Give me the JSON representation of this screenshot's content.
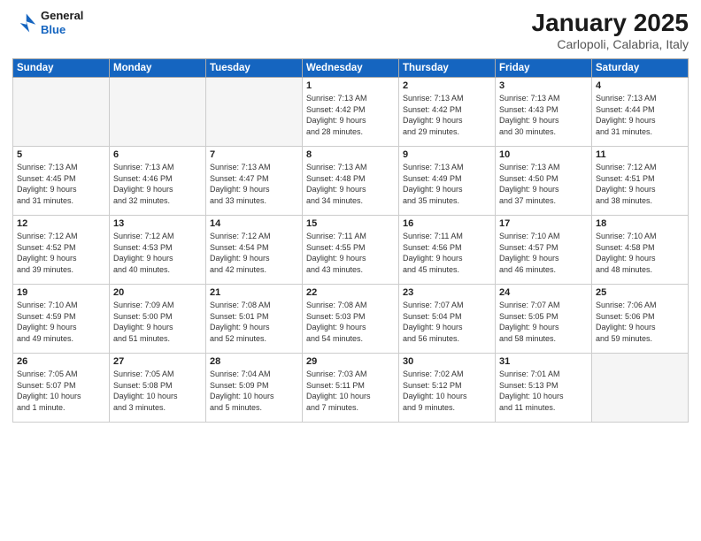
{
  "logo": {
    "line1": "General",
    "line2": "Blue"
  },
  "header": {
    "title": "January 2025",
    "location": "Carlopoli, Calabria, Italy"
  },
  "weekdays": [
    "Sunday",
    "Monday",
    "Tuesday",
    "Wednesday",
    "Thursday",
    "Friday",
    "Saturday"
  ],
  "weeks": [
    [
      {
        "day": "",
        "info": ""
      },
      {
        "day": "",
        "info": ""
      },
      {
        "day": "",
        "info": ""
      },
      {
        "day": "1",
        "info": "Sunrise: 7:13 AM\nSunset: 4:42 PM\nDaylight: 9 hours\nand 28 minutes."
      },
      {
        "day": "2",
        "info": "Sunrise: 7:13 AM\nSunset: 4:42 PM\nDaylight: 9 hours\nand 29 minutes."
      },
      {
        "day": "3",
        "info": "Sunrise: 7:13 AM\nSunset: 4:43 PM\nDaylight: 9 hours\nand 30 minutes."
      },
      {
        "day": "4",
        "info": "Sunrise: 7:13 AM\nSunset: 4:44 PM\nDaylight: 9 hours\nand 31 minutes."
      }
    ],
    [
      {
        "day": "5",
        "info": "Sunrise: 7:13 AM\nSunset: 4:45 PM\nDaylight: 9 hours\nand 31 minutes."
      },
      {
        "day": "6",
        "info": "Sunrise: 7:13 AM\nSunset: 4:46 PM\nDaylight: 9 hours\nand 32 minutes."
      },
      {
        "day": "7",
        "info": "Sunrise: 7:13 AM\nSunset: 4:47 PM\nDaylight: 9 hours\nand 33 minutes."
      },
      {
        "day": "8",
        "info": "Sunrise: 7:13 AM\nSunset: 4:48 PM\nDaylight: 9 hours\nand 34 minutes."
      },
      {
        "day": "9",
        "info": "Sunrise: 7:13 AM\nSunset: 4:49 PM\nDaylight: 9 hours\nand 35 minutes."
      },
      {
        "day": "10",
        "info": "Sunrise: 7:13 AM\nSunset: 4:50 PM\nDaylight: 9 hours\nand 37 minutes."
      },
      {
        "day": "11",
        "info": "Sunrise: 7:12 AM\nSunset: 4:51 PM\nDaylight: 9 hours\nand 38 minutes."
      }
    ],
    [
      {
        "day": "12",
        "info": "Sunrise: 7:12 AM\nSunset: 4:52 PM\nDaylight: 9 hours\nand 39 minutes."
      },
      {
        "day": "13",
        "info": "Sunrise: 7:12 AM\nSunset: 4:53 PM\nDaylight: 9 hours\nand 40 minutes."
      },
      {
        "day": "14",
        "info": "Sunrise: 7:12 AM\nSunset: 4:54 PM\nDaylight: 9 hours\nand 42 minutes."
      },
      {
        "day": "15",
        "info": "Sunrise: 7:11 AM\nSunset: 4:55 PM\nDaylight: 9 hours\nand 43 minutes."
      },
      {
        "day": "16",
        "info": "Sunrise: 7:11 AM\nSunset: 4:56 PM\nDaylight: 9 hours\nand 45 minutes."
      },
      {
        "day": "17",
        "info": "Sunrise: 7:10 AM\nSunset: 4:57 PM\nDaylight: 9 hours\nand 46 minutes."
      },
      {
        "day": "18",
        "info": "Sunrise: 7:10 AM\nSunset: 4:58 PM\nDaylight: 9 hours\nand 48 minutes."
      }
    ],
    [
      {
        "day": "19",
        "info": "Sunrise: 7:10 AM\nSunset: 4:59 PM\nDaylight: 9 hours\nand 49 minutes."
      },
      {
        "day": "20",
        "info": "Sunrise: 7:09 AM\nSunset: 5:00 PM\nDaylight: 9 hours\nand 51 minutes."
      },
      {
        "day": "21",
        "info": "Sunrise: 7:08 AM\nSunset: 5:01 PM\nDaylight: 9 hours\nand 52 minutes."
      },
      {
        "day": "22",
        "info": "Sunrise: 7:08 AM\nSunset: 5:03 PM\nDaylight: 9 hours\nand 54 minutes."
      },
      {
        "day": "23",
        "info": "Sunrise: 7:07 AM\nSunset: 5:04 PM\nDaylight: 9 hours\nand 56 minutes."
      },
      {
        "day": "24",
        "info": "Sunrise: 7:07 AM\nSunset: 5:05 PM\nDaylight: 9 hours\nand 58 minutes."
      },
      {
        "day": "25",
        "info": "Sunrise: 7:06 AM\nSunset: 5:06 PM\nDaylight: 9 hours\nand 59 minutes."
      }
    ],
    [
      {
        "day": "26",
        "info": "Sunrise: 7:05 AM\nSunset: 5:07 PM\nDaylight: 10 hours\nand 1 minute."
      },
      {
        "day": "27",
        "info": "Sunrise: 7:05 AM\nSunset: 5:08 PM\nDaylight: 10 hours\nand 3 minutes."
      },
      {
        "day": "28",
        "info": "Sunrise: 7:04 AM\nSunset: 5:09 PM\nDaylight: 10 hours\nand 5 minutes."
      },
      {
        "day": "29",
        "info": "Sunrise: 7:03 AM\nSunset: 5:11 PM\nDaylight: 10 hours\nand 7 minutes."
      },
      {
        "day": "30",
        "info": "Sunrise: 7:02 AM\nSunset: 5:12 PM\nDaylight: 10 hours\nand 9 minutes."
      },
      {
        "day": "31",
        "info": "Sunrise: 7:01 AM\nSunset: 5:13 PM\nDaylight: 10 hours\nand 11 minutes."
      },
      {
        "day": "",
        "info": ""
      }
    ]
  ]
}
